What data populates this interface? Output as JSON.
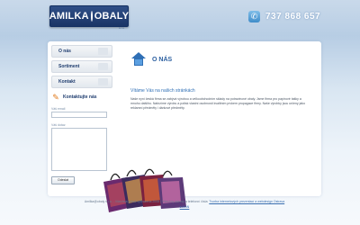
{
  "header": {
    "logo_text_left": "AMILKA",
    "logo_text_right": "OBALY",
    "logo_sub": "s.r.o.",
    "phone": "737 868 657"
  },
  "nav": {
    "items": [
      {
        "label": "O nás"
      },
      {
        "label": "Sortiment"
      },
      {
        "label": "Kontakt"
      }
    ]
  },
  "contact": {
    "title": "Kontaktujte nás",
    "email_label": "Váš email",
    "message_label": "Váš dotaz",
    "send_label": "Odeslat"
  },
  "main": {
    "section_title": "O NÁS",
    "welcome": "Vítáme Vás na našich stránkách",
    "intro": "Naše nyní česká firma se zabývá výrobou a velkoobchodním sklady na potravinové obaly. Jsme firma pro papírové tašky a mnoho dalšího. Nabízíme výrobu a potisk vlastní osobností kvalitním prvkem propagace firmy. Naše výrobky jsou určeny jako reklamní předměty i dárkové předměty."
  },
  "footer": {
    "copyright": "Amilka@obaly s.r.o. - Všechna práva vyhrazena 2008 | Všechny adresy a telefonní čísla:",
    "link": "Tvorba internetových prezentací a webdesign Ostrava",
    "link2": "e.MAN"
  },
  "colors": {
    "brand_blue": "#1e3c6e",
    "accent_blue": "#2b5fa0",
    "background": "#c9d9ea"
  }
}
